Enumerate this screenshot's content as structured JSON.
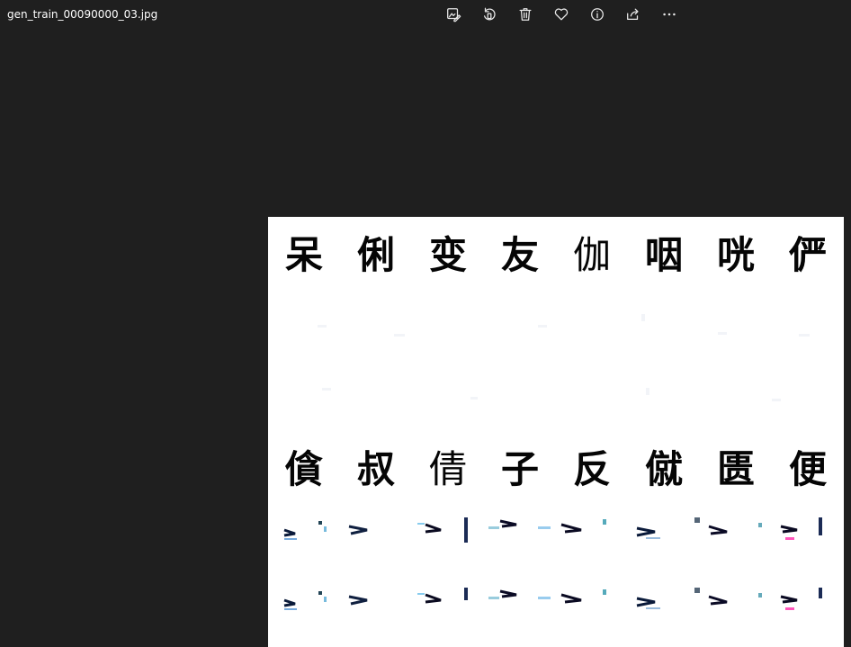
{
  "window": {
    "title": "gen_train_00090000_03.jpg"
  },
  "toolbar": {
    "buttons": [
      {
        "name": "edit-image-button",
        "icon": "edit-image-icon"
      },
      {
        "name": "rotate-button",
        "icon": "rotate-icon"
      },
      {
        "name": "delete-button",
        "icon": "trash-icon"
      },
      {
        "name": "favorite-button",
        "icon": "heart-icon"
      },
      {
        "name": "file-info-button",
        "icon": "info-icon"
      },
      {
        "name": "share-button",
        "icon": "share-icon"
      },
      {
        "name": "more-options-button",
        "icon": "more-icon"
      }
    ]
  },
  "image": {
    "row1": [
      "呆",
      "俐",
      "变",
      "友",
      "伽",
      "咽",
      "咣",
      "俨"
    ],
    "row2": [
      "僋",
      "叔",
      "倩",
      "子",
      "反",
      "僦",
      "匮",
      "便"
    ]
  },
  "colors": {
    "background": "#1f1f1f",
    "image_background": "#ffffff",
    "text": "#ffffff"
  }
}
